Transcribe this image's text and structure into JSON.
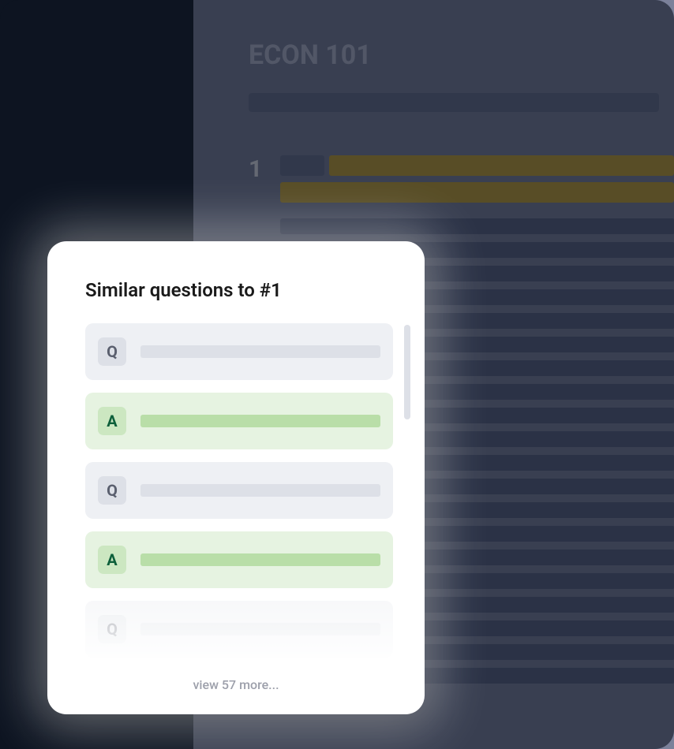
{
  "course": {
    "title": "ECON 101"
  },
  "question": {
    "number": "1"
  },
  "popup": {
    "title": "Similar questions to #1",
    "items": [
      {
        "type": "Q",
        "label": "Q"
      },
      {
        "type": "A",
        "label": "A"
      },
      {
        "type": "Q",
        "label": "Q"
      },
      {
        "type": "A",
        "label": "A"
      },
      {
        "type": "Q",
        "label": "Q"
      }
    ],
    "view_more": "view 57 more..."
  }
}
